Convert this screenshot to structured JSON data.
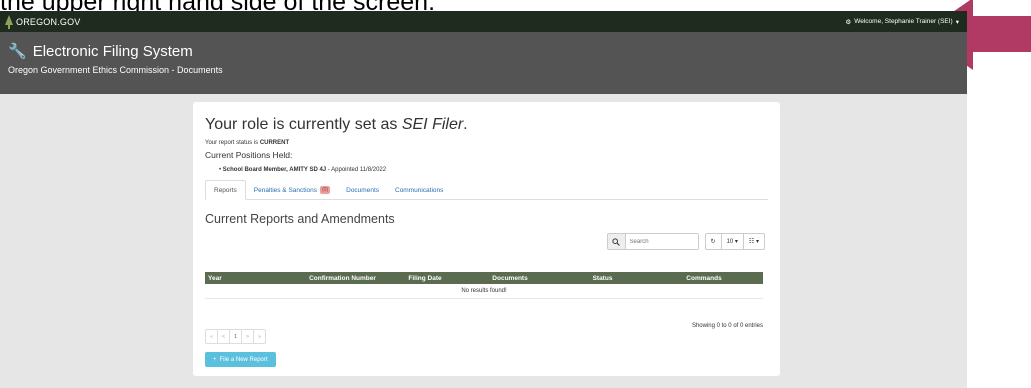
{
  "caption": "the upper right hand side of the screen.",
  "colors": {
    "arrow": "#b03a64",
    "topbar": "#1f2b1f",
    "header": "#545454",
    "table_header": "#5a6b50",
    "accent_button": "#5bc0de"
  },
  "topbar": {
    "brand": "OREGON.GOV",
    "welcome": "Welcome, Stephanie Trainer (SEI)"
  },
  "header": {
    "title": "Electronic Filing System",
    "subtitle": "Oregon Government Ethics Commission - Documents"
  },
  "role": {
    "prefix": "Your role is currently set as ",
    "role_name": "SEI Filer",
    "suffix": "."
  },
  "status": {
    "label": "Your report status is ",
    "value": "CURRENT"
  },
  "positions": {
    "label": "Current Positions Held:",
    "items": [
      {
        "title": "School Board Member, AMITY SD 4J",
        "note": " - Appointed 11/8/2022"
      }
    ]
  },
  "tabs": [
    {
      "label": "Reports"
    },
    {
      "label": "Penalties & Sanctions",
      "badge": "(0)"
    },
    {
      "label": "Documents"
    },
    {
      "label": "Communications"
    }
  ],
  "reports": {
    "heading": "Current Reports and Amendments",
    "search_placeholder": "Search",
    "page_size": "10",
    "columns": [
      "Year",
      "Confirmation Number",
      "Filing Date",
      "Documents",
      "Status",
      "Commands"
    ],
    "empty_message": "No results found!",
    "pager": [
      "«",
      "<",
      "1",
      ">",
      "»"
    ],
    "showing": "Showing 0 to 0 of 0 entries",
    "file_button": "File a New Report"
  }
}
